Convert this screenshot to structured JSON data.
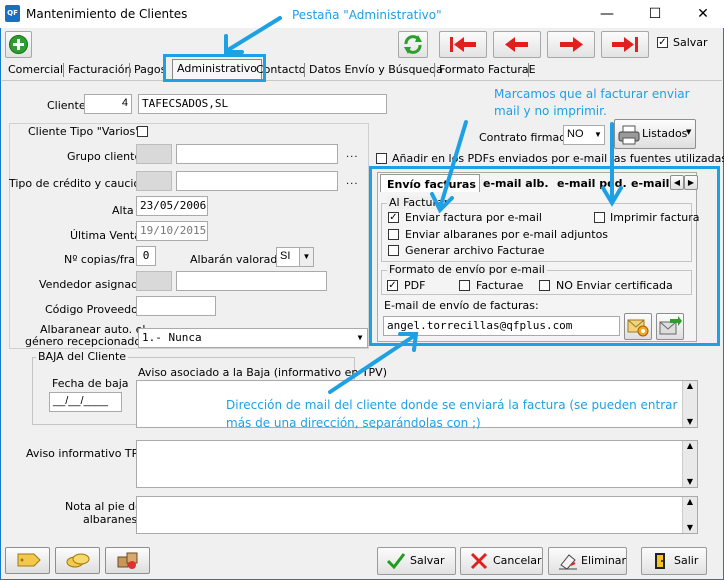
{
  "window": {
    "title": "Mantenimiento de Clientes",
    "app_icon_text": "QF"
  },
  "toolbar": {
    "save_check_label": "Salvar",
    "save_checked": true
  },
  "tabs": [
    "Comercial",
    "Facturación",
    "Pagos",
    "Administrativo",
    "Contacto",
    "Datos Envío y Búsqueda",
    "Formato FacturaE"
  ],
  "form": {
    "cliente_label": "Cliente",
    "cliente_num": "4",
    "cliente_name": "TAFECSADOS,SL",
    "tipo_varios_label": "Cliente Tipo \"Varios\"",
    "contrato_label": "Contrato firmado",
    "contrato_value": "NO",
    "listados_label": "Listados",
    "grupo_label": "Grupo cliente",
    "anadir_pdf_label": "Añadir en los PDFs enviados por e-mail las fuentes utilizadas",
    "tipo_credito_label": "Tipo de crédito y caución",
    "alta_label": "Alta",
    "alta_value": "23/05/2006",
    "ultima_venta_label": "Última Venta",
    "ultima_venta_value": "19/10/2015",
    "copias_label": "Nº copias/fra.",
    "copias_value": "0",
    "albaran_valorado_label": "Albarán valorado",
    "albaran_valorado_value": "SI",
    "vendedor_label": "Vendedor asignado",
    "codigo_proveedor_label": "Código Proveedor",
    "albaranear_label_1": "Albaranear auto. el",
    "albaranear_label_2": "género recepcionado:",
    "albaranear_value": "1.- Nunca",
    "baja_group": "BAJA del Cliente",
    "fecha_baja_label": "Fecha de baja",
    "fecha_baja_value": "__/__/____",
    "aviso_baja_label": "Aviso asociado a la Baja (informativo en TPV)",
    "aviso_tpv_label": "Aviso informativo TPV",
    "nota_label_1": "Nota al pie de",
    "nota_label_2": "albaranes"
  },
  "email_panel": {
    "subtabs": [
      "Envío facturas",
      "e-mail alb.",
      "e-mail ped.",
      "e-mail"
    ],
    "al_facturar_label": "Al Facturar",
    "enviar_factura_label": "Enviar factura por e-mail",
    "imprimir_label": "Imprimir factura",
    "enviar_albaranes_label": "Enviar albaranes por e-mail adjuntos",
    "generar_facturae_label": "Generar archivo Facturae",
    "formato_group_label": "Formato de envío por e-mail",
    "pdf_label": "PDF",
    "facturae_label": "Facturae",
    "no_enviar_cert_label": "NO Enviar certificada",
    "email_label": "E-mail de envío de facturas:",
    "email_value": "angel.torrecillas@qfplus.com"
  },
  "annotations": {
    "tab_note": "Pestaña \"Administrativo\"",
    "mark_note_1": "Marcamos que al facturar enviar",
    "mark_note_2": "mail y no imprimir.",
    "email_note_1": "Dirección de mail del cliente donde se enviará la factura (se pueden entrar",
    "email_note_2": "más de una dirección, separándolas con ;)"
  },
  "bottom_buttons": {
    "save": "Salvar",
    "cancel": "Cancelar",
    "delete": "Eliminar",
    "exit": "Salir"
  }
}
